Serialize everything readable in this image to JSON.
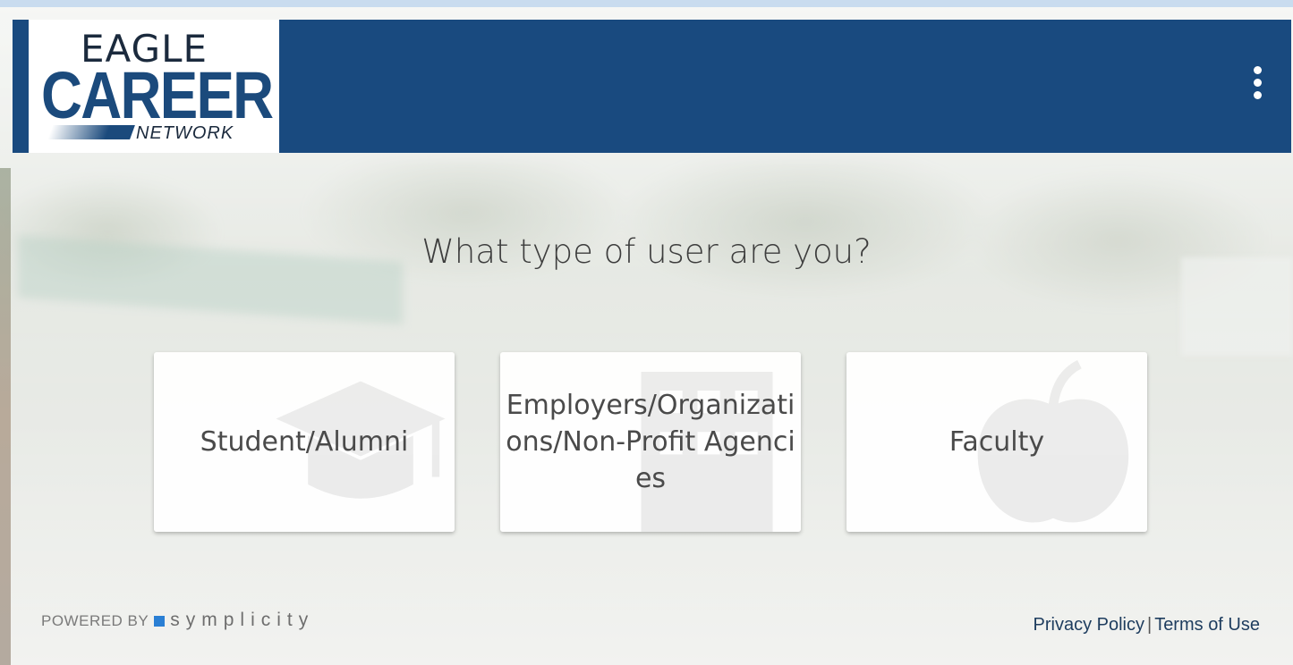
{
  "header": {
    "logo": {
      "line1": "EAGLE",
      "line2": "CAREER",
      "line3": "NETWORK"
    },
    "menu_icon": "more-vertical-icon",
    "color": "#194a7f"
  },
  "main": {
    "prompt": "What type of user are you?",
    "cards": [
      {
        "label": "Student/Alumni",
        "icon": "graduation-cap-icon"
      },
      {
        "label": "Employers/Organizations/Non-Profit Agencies",
        "icon": "building-icon"
      },
      {
        "label": "Faculty",
        "icon": "apple-icon"
      }
    ]
  },
  "footer": {
    "powered_by": "POWERED BY",
    "brand": "symplicity",
    "brand_color": "#2a7fd4",
    "privacy_policy": "Privacy Policy",
    "separator": "|",
    "terms_of_use": "Terms of Use"
  }
}
